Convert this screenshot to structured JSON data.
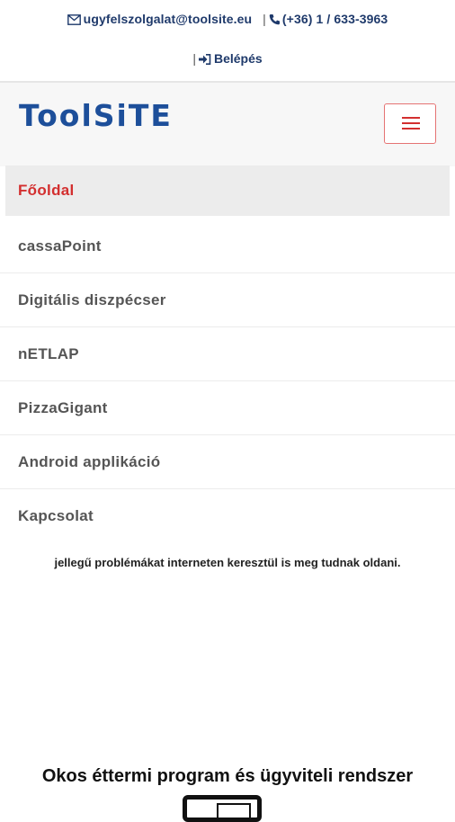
{
  "topbar": {
    "email": "ugyfelszolgalat@toolsite.eu",
    "phone": "(+36) 1 / 633-3963",
    "login_label": "Belépés",
    "separator": "|"
  },
  "navbar": {
    "brand": "ToolSiTE",
    "toggle_icon": "hamburger-menu-icon"
  },
  "menu": {
    "items": [
      {
        "label": "Főoldal",
        "active": true
      },
      {
        "label": "cassaPoint"
      },
      {
        "label": "Digitális diszpécser"
      },
      {
        "label": "nETLAP"
      },
      {
        "label": "PizzaGigant"
      },
      {
        "label": "Android applikáció"
      },
      {
        "label": "Kapcsolat"
      }
    ]
  },
  "content": {
    "paragraph_tail": "jellegű problémákat interneten keresztül is meg tudnak oldani.",
    "section_heading": "Okos éttermi program és ügyviteli rendszer"
  },
  "colors": {
    "brand": "#1d4f9a",
    "accent": "#d32f2f",
    "link": "#1f3a6b"
  }
}
